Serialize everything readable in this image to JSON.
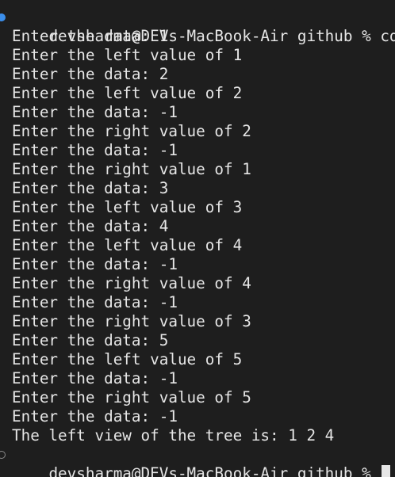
{
  "terminal": {
    "first_prompt": "devsharma@DEVs-MacBook-Air github % cd \"/",
    "last_prompt": "devsharma@DEVs-MacBook-Air github % ",
    "output_lines": [
      "Enter the data: 1",
      "Enter the left value of 1",
      "Enter the data: 2",
      "Enter the left value of 2",
      "Enter the data: -1",
      "Enter the right value of 2",
      "Enter the data: -1",
      "Enter the right value of 1",
      "Enter the data: 3",
      "Enter the left value of 3",
      "Enter the data: 4",
      "Enter the left value of 4",
      "Enter the data: -1",
      "Enter the right value of 4",
      "Enter the data: -1",
      "Enter the right value of 3",
      "Enter the data: 5",
      "Enter the left value of 5",
      "Enter the data: -1",
      "Enter the right value of 5",
      "Enter the data: -1",
      "The left view of the tree is: 1 2 4"
    ]
  },
  "colors": {
    "background": "#1e1e1e",
    "text": "#e6e6e6",
    "success_marker": "#3b8eea",
    "idle_marker": "#8a8a8a"
  }
}
